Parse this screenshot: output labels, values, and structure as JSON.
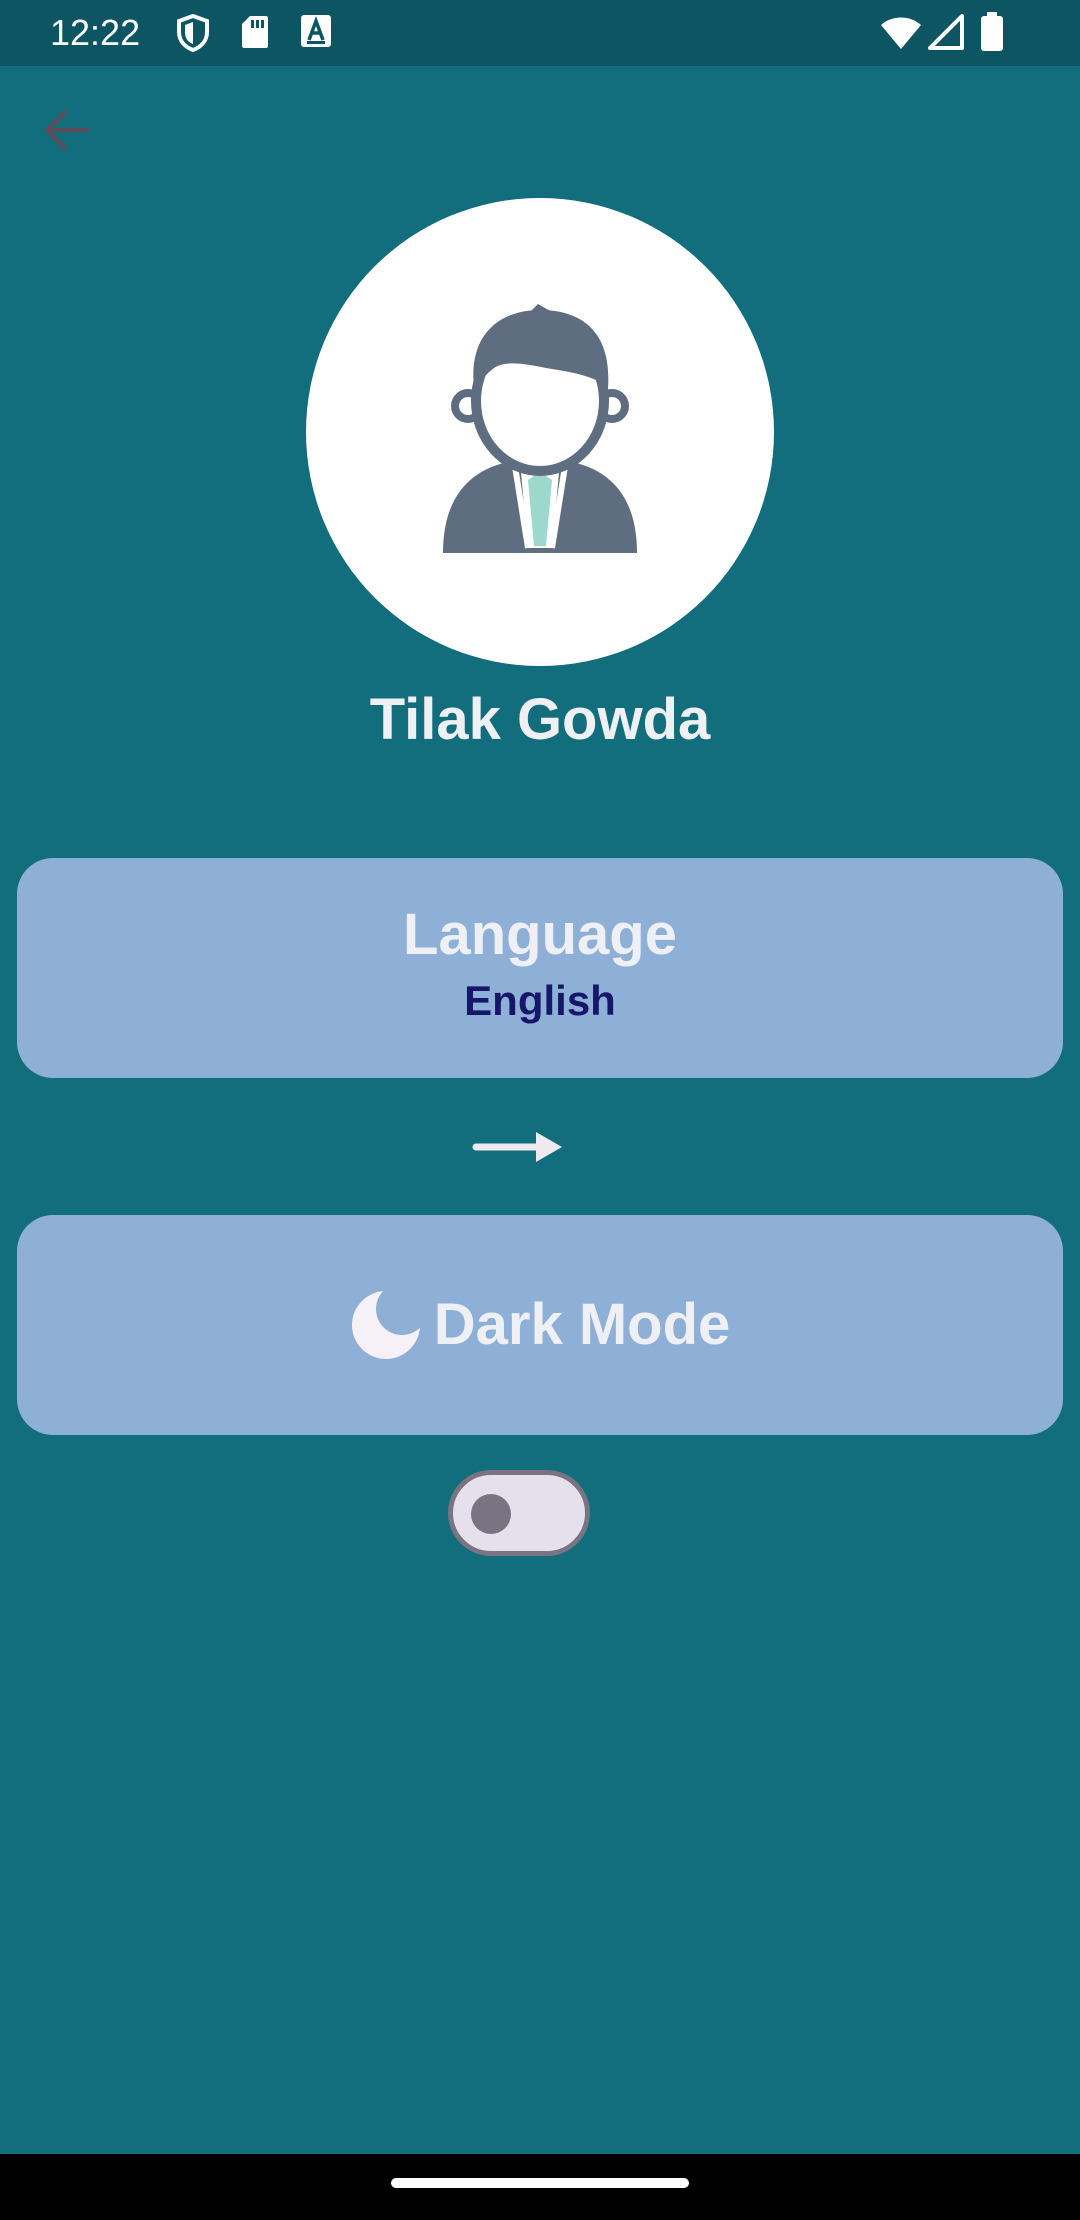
{
  "status_bar": {
    "time": "12:22",
    "icons": [
      "shield-icon",
      "sd-card-icon",
      "font-a-icon",
      "wifi-icon",
      "signal-icon",
      "battery-icon"
    ]
  },
  "header": {
    "back_icon": "arrow-left-icon"
  },
  "profile": {
    "avatar_icon": "businessman-avatar-icon",
    "name": "Tilak Gowda"
  },
  "language_card": {
    "title": "Language",
    "value": "English"
  },
  "arrow_icon": "arrow-right-icon",
  "dark_mode_card": {
    "icon": "moon-icon",
    "label": "Dark Mode"
  },
  "dark_mode_toggle": {
    "enabled": false
  },
  "colors": {
    "background": "#126e7c",
    "status_bar": "#0d5563",
    "card": "#8fb0d6",
    "language_value": "#16166a",
    "avatar_figure": "#5e6e80",
    "tie": "#9cd8cc"
  }
}
